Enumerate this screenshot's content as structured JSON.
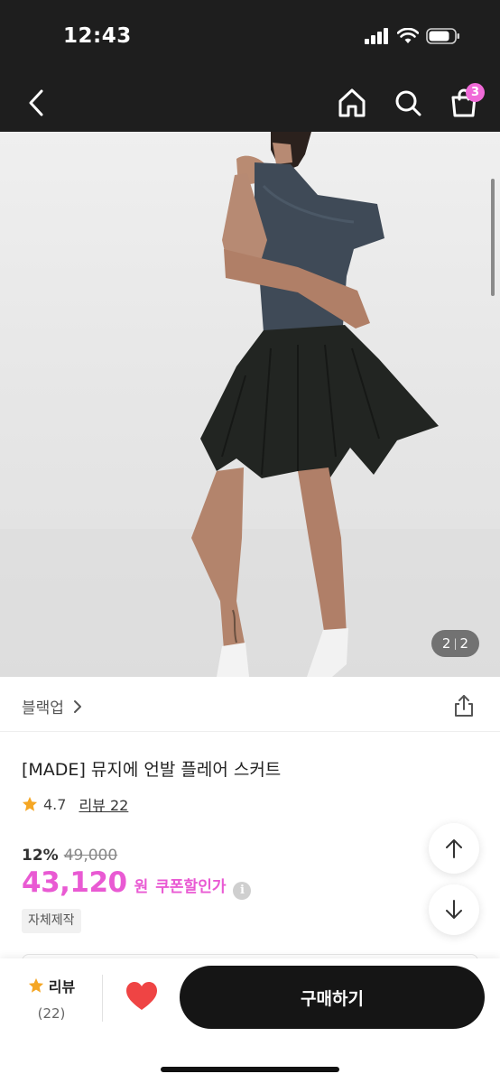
{
  "status_bar": {
    "time": "12:43"
  },
  "nav": {
    "cart_count": "3"
  },
  "hero": {
    "page_current": "2",
    "page_total": "2"
  },
  "product": {
    "brand": "블랙업",
    "title": "[MADE] 뮤지에 언발 플레어 스커트",
    "rating": "4.7",
    "review_link": "리뷰 22",
    "discount": "12%",
    "original_price": "49,000",
    "price": "43,120",
    "currency": "원",
    "coupon_label": "쿠폰할인가",
    "tag": "자체제작"
  },
  "bottom_bar": {
    "review_label": "리뷰",
    "review_count": "(22)",
    "buy_label": "구매하기"
  },
  "icons": {
    "back": "chevron-left-icon",
    "home": "home-icon",
    "search": "search-icon",
    "cart": "shopping-bag-icon",
    "share": "share-icon",
    "star": "star-icon",
    "info": "info-icon",
    "scroll_up": "arrow-up-icon",
    "scroll_down": "arrow-down-icon",
    "like": "heart-icon"
  },
  "colors": {
    "accent": "#e95ad3",
    "badge": "#f06ad8",
    "heart": "#ef4444",
    "star": "#f5a623",
    "header": "#1e1e1e"
  }
}
